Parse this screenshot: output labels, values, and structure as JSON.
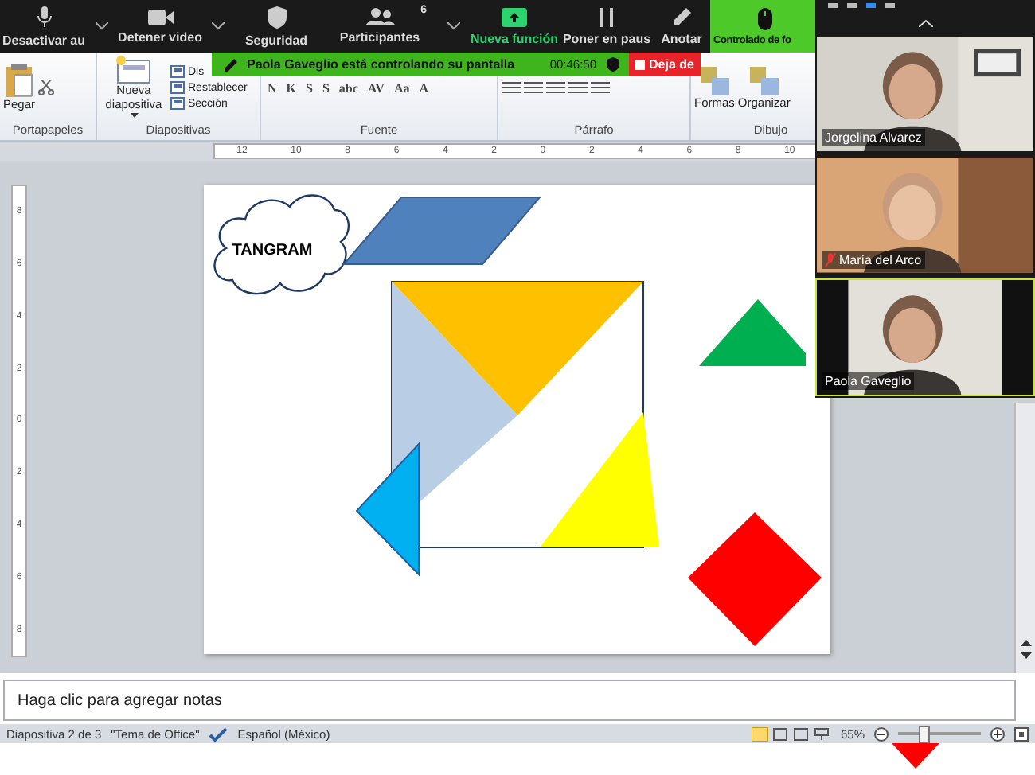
{
  "meeting_toolbar": {
    "items": [
      {
        "kind": "mic",
        "label": "Desactivar au"
      },
      {
        "kind": "caret"
      },
      {
        "kind": "video",
        "label": "Detener video"
      },
      {
        "kind": "caret"
      },
      {
        "kind": "shield",
        "label": "Seguridad"
      },
      {
        "kind": "people",
        "label": "Participantes",
        "count": "6"
      },
      {
        "kind": "caret"
      },
      {
        "kind": "new",
        "label": "Nueva función"
      },
      {
        "kind": "pause",
        "label": "Poner en paus"
      },
      {
        "kind": "pen",
        "label": "Anotar"
      },
      {
        "kind": "mouse",
        "label": "Controlado de fo"
      }
    ]
  },
  "control_banner": {
    "text": "Paola Gaveglio está controlando su pantalla",
    "timer": "00:46:50",
    "stop_button": "Deja de"
  },
  "ribbon": {
    "groups": [
      {
        "label": "Portapapeles",
        "items": [
          {
            "kind": "paste",
            "label": "Pegar"
          }
        ]
      },
      {
        "label": "Diapositivas",
        "items": [
          {
            "kind": "newslide",
            "label": "Nueva diapositiva"
          },
          {
            "kind": "small",
            "label": "Dis"
          },
          {
            "kind": "small",
            "label": "Restablecer"
          },
          {
            "kind": "small",
            "label": "Sección"
          }
        ]
      },
      {
        "label": "Fuente",
        "items": [
          {
            "kind": "format",
            "label": "N"
          },
          {
            "kind": "format",
            "label": "K"
          },
          {
            "kind": "format",
            "label": "S"
          },
          {
            "kind": "format",
            "label": "S"
          },
          {
            "kind": "format",
            "label": "abc"
          },
          {
            "kind": "format",
            "label": "AV"
          },
          {
            "kind": "format",
            "label": "Aa"
          },
          {
            "kind": "format",
            "label": "A"
          }
        ]
      },
      {
        "label": "Párrafo",
        "items": [
          {
            "kind": "align"
          },
          {
            "kind": "align"
          },
          {
            "kind": "align"
          },
          {
            "kind": "align"
          },
          {
            "kind": "align"
          }
        ]
      },
      {
        "label": "Dibujo",
        "items": [
          {
            "kind": "large",
            "label": "Formas"
          },
          {
            "kind": "large",
            "label": "Organizar"
          }
        ]
      }
    ]
  },
  "rulers": {
    "horizontal": [
      "12",
      "10",
      "8",
      "6",
      "4",
      "2",
      "0",
      "2",
      "4",
      "6",
      "8",
      "10"
    ],
    "vertical": [
      "8",
      "6",
      "4",
      "2",
      "0",
      "2",
      "4",
      "6",
      "8"
    ]
  },
  "slide": {
    "cloud_text": "TANGRAM"
  },
  "video_panel": {
    "tiles": [
      {
        "name": "Jorgelina Alvarez",
        "muted": false,
        "selected": false
      },
      {
        "name": "María del Arco",
        "muted": true,
        "selected": false
      },
      {
        "name": "Paola Gaveglio",
        "muted": false,
        "selected": true
      }
    ]
  },
  "notes": {
    "placeholder": "Haga clic para agregar notas"
  },
  "status_bar": {
    "slide": "Diapositiva 2 de 3",
    "theme": "\"Tema de Office\"",
    "language": "Español (México)",
    "zoom": "65%",
    "zoom_slider": {
      "level": 0.3
    }
  }
}
